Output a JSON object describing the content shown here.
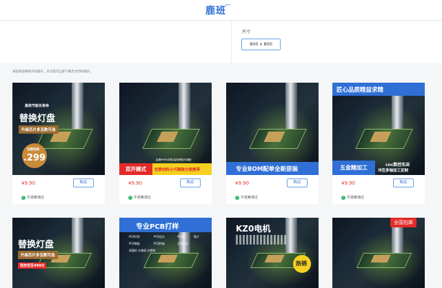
{
  "header": {
    "logo": "鹿班",
    "beta": "BETA"
  },
  "options": {
    "size_label": "尺寸",
    "size_value": "800 x 800"
  },
  "hint": "请选择您要购买的图片，支付后可立即下载无水印的图片。",
  "common": {
    "price": "¥9.90",
    "buy_label": "购买",
    "verified_label": "牛皮癣通过",
    "verified_icon": "check-circle-icon"
  },
  "cards": [
    {
      "lines": [
        "高亮节能长寿命",
        "替换灯盘",
        "升级芯片多瓦数可选",
        "全国包邮",
        ".299"
      ]
    },
    {
      "lines": [
        "高透PMMA材质/高效率格/可调配",
        "双开模式",
        "优质材料小巧精致方便携带"
      ]
    },
    {
      "lines": [
        "专业BOM配单全新原装"
      ]
    },
    {
      "lines": [
        "匠心品质精益求精",
        "五金精加工",
        "cnc数控车床",
        "冲压多轴加工定制"
      ]
    },
    {
      "lines": [
        "替换灯盘",
        "升级芯片多瓦数可选",
        "限定优至499元"
      ]
    },
    {
      "lines": [
        "专业PCB打样",
        "PCB打样",
        "PCB设计",
        "PCBA",
        "贴片",
        "PCB制板",
        "PCB抄板",
        "方案设计",
        "质量好 价格低 交期快"
      ]
    },
    {
      "lines": [
        "KZ0电机",
        "热销"
      ]
    },
    {
      "lines": [
        "全国包邮"
      ]
    }
  ]
}
